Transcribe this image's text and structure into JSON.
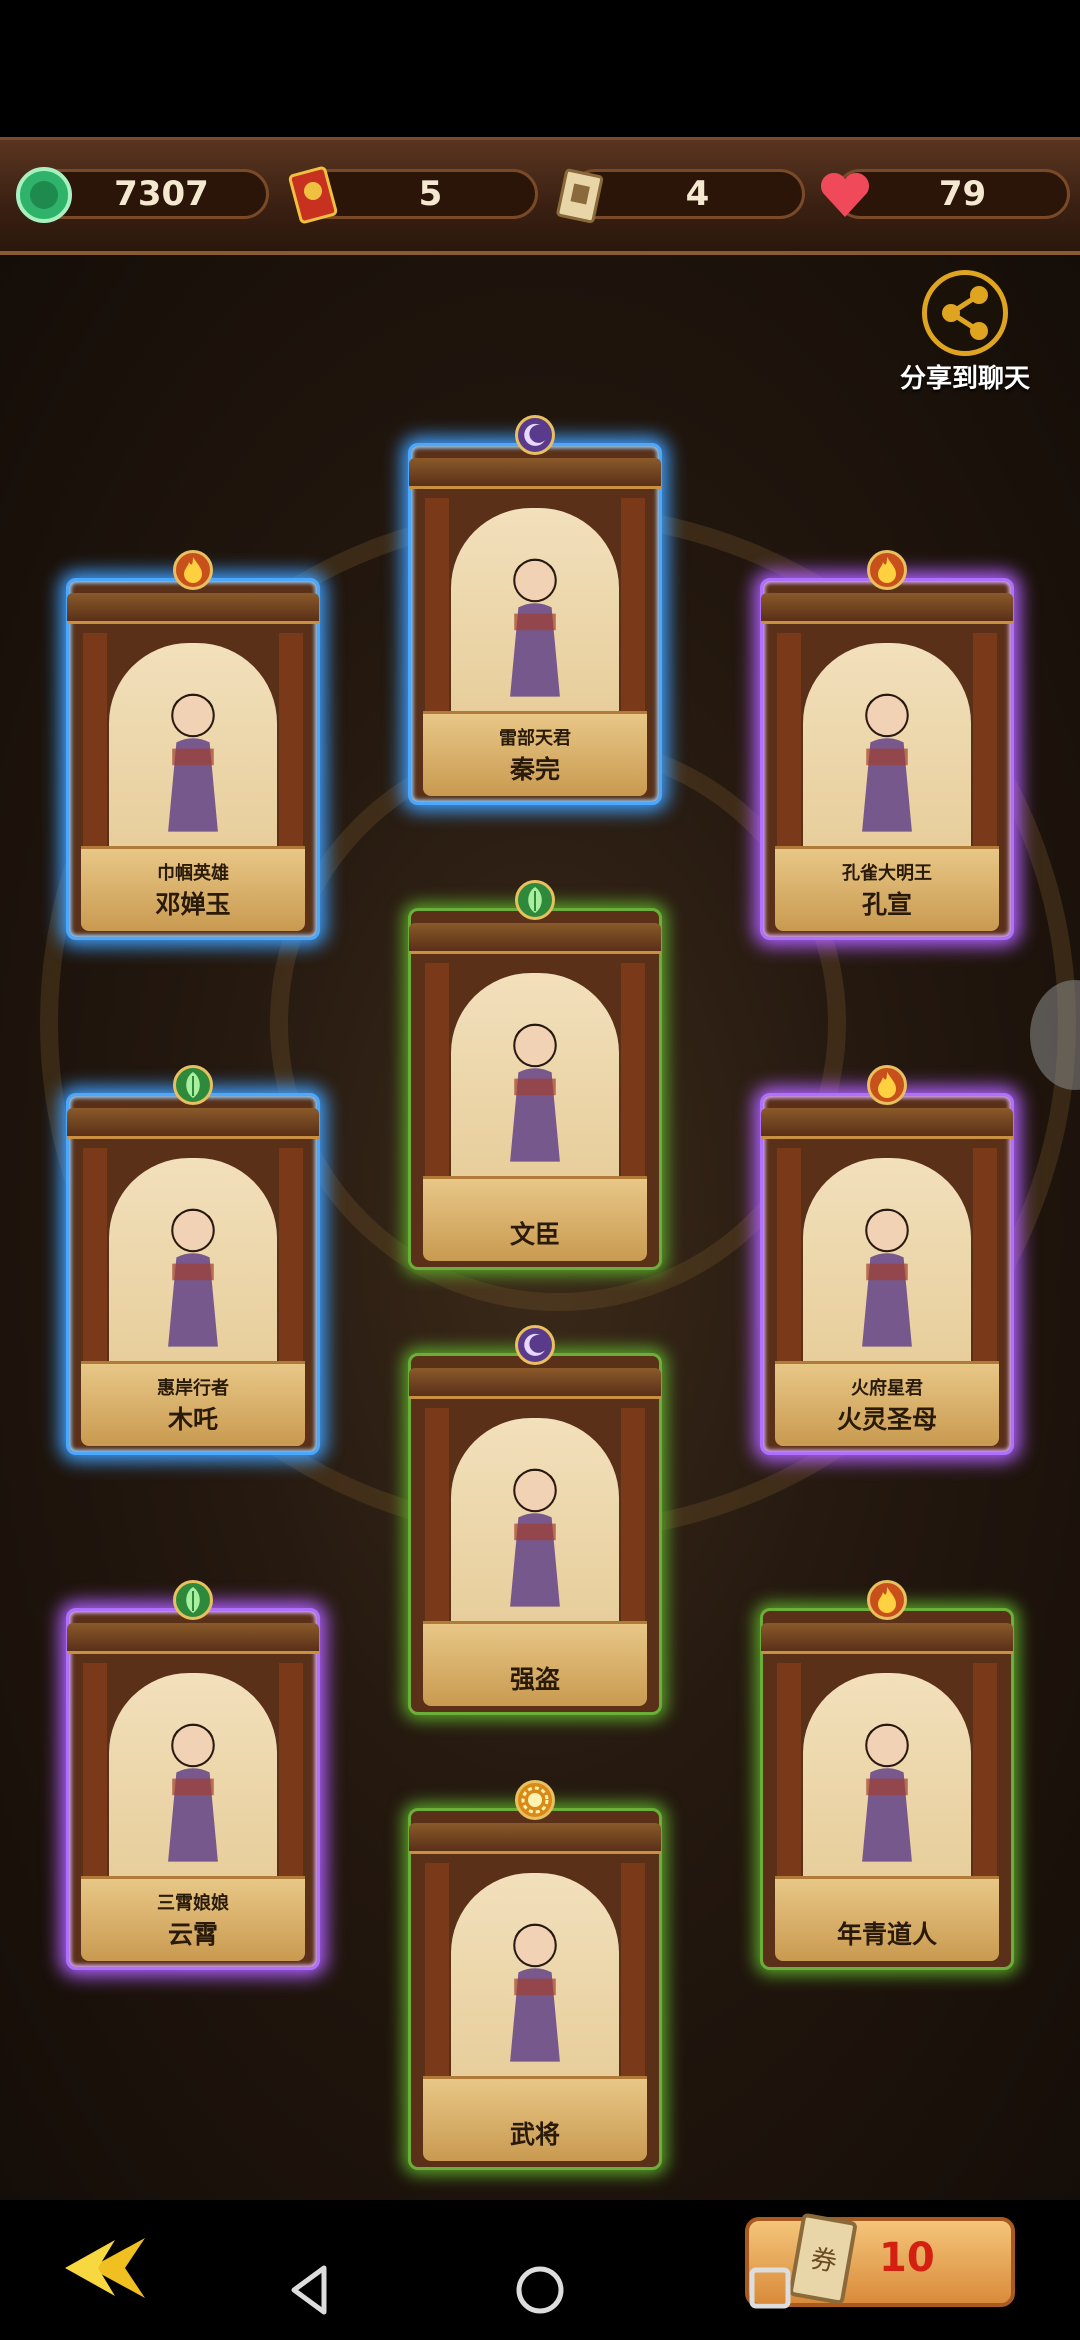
{
  "resources": {
    "jade": {
      "value": "7307",
      "icon": "jade-coin-icon"
    },
    "scroll": {
      "value": "5",
      "icon": "fortune-scroll-icon"
    },
    "ticket": {
      "value": "4",
      "icon": "ticket-icon"
    },
    "heart": {
      "value": "79",
      "icon": "heart-icon"
    }
  },
  "share": {
    "label": "分享到聊天"
  },
  "cards": [
    {
      "title": "巾帼英雄",
      "name": "邓婵玉",
      "element": "fire",
      "glow": "blue"
    },
    {
      "title": "雷部天君",
      "name": "秦完",
      "element": "moon",
      "glow": "blue"
    },
    {
      "title": "孔雀大明王",
      "name": "孔宣",
      "element": "fire",
      "glow": "purple"
    },
    {
      "title": "",
      "name": "文臣",
      "element": "leaf",
      "glow": "green"
    },
    {
      "title": "惠岸行者",
      "name": "木吒",
      "element": "leaf",
      "glow": "blue"
    },
    {
      "title": "火府星君",
      "name": "火灵圣母",
      "element": "fire",
      "glow": "purple"
    },
    {
      "title": "",
      "name": "强盗",
      "element": "moon",
      "glow": "green"
    },
    {
      "title": "三霄娘娘",
      "name": "云霄",
      "element": "leaf",
      "glow": "purple"
    },
    {
      "title": "",
      "name": "年青道人",
      "element": "fire",
      "glow": "green"
    },
    {
      "title": "",
      "name": "武将",
      "element": "sun",
      "glow": "green"
    }
  ],
  "draw_button": {
    "count": "10",
    "icon": "ticket-icon"
  },
  "colors": {
    "blue_glow": "#3fa0ff",
    "purple_glow": "#b060ff",
    "green_glow": "#5aa02a",
    "gold": "#e0a520"
  }
}
